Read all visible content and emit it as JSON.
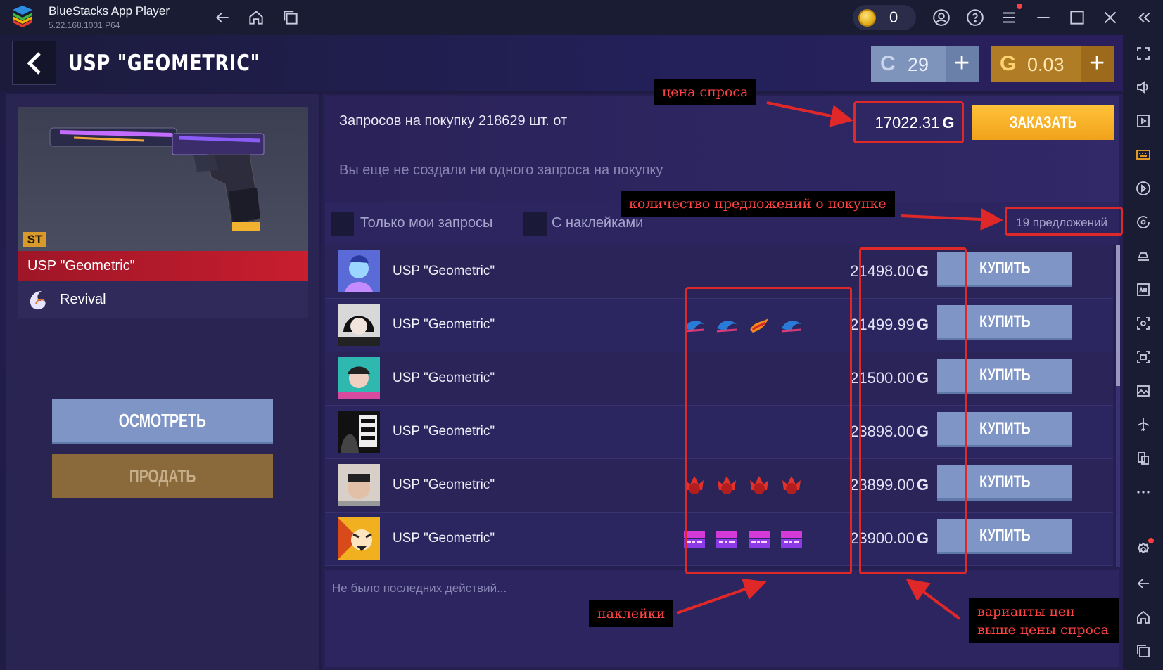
{
  "titlebar": {
    "app_name": "BlueStacks App Player",
    "version": "5.22.168.1001  P64",
    "coins": "0"
  },
  "sidebar_icons": [
    "fullscreen-icon",
    "volume-icon",
    "video-icon",
    "keyboard-icon",
    "play-icon",
    "rotate-icon",
    "shake-icon",
    "apk-icon",
    "screenshot-icon",
    "screen-record-icon",
    "media-icon",
    "airplane-icon",
    "multi-instance-icon",
    "more-icon",
    "settings-icon",
    "back-icon",
    "home-icon",
    "recent-apps-icon"
  ],
  "header": {
    "title": "USP \"GEOMETRIC\"",
    "silver_currency": "29",
    "gold_currency": "0.03"
  },
  "item": {
    "badge": "ST",
    "name": "USP \"Geometric\"",
    "collection": "Revival",
    "inspect_label": "ОСМОТРЕТЬ",
    "sell_label": "ПРОДАТЬ"
  },
  "request": {
    "text": "Запросов на покупку 218629 шт. от",
    "price": "17022.31",
    "order_label": "ЗАКАЗАТЬ",
    "none_text": "Вы еще не создали ни одного запроса на покупку"
  },
  "filters": {
    "only_mine": "Только мои запросы",
    "with_stickers": "С наклейками",
    "offers_count": "19 предложений"
  },
  "listings": [
    {
      "name": "USP \"Geometric\"",
      "price": "21498.00",
      "buy": "КУПИТЬ",
      "stickers": []
    },
    {
      "name": "USP \"Geometric\"",
      "price": "21499.99",
      "buy": "КУПИТЬ",
      "stickers": [
        "blue-shark-sticker",
        "blue-shark-sticker",
        "flame-sticker",
        "blue-shark-sticker"
      ]
    },
    {
      "name": "USP \"Geometric\"",
      "price": "21500.00",
      "buy": "КУПИТЬ",
      "stickers": []
    },
    {
      "name": "USP \"Geometric\"",
      "price": "23898.00",
      "buy": "КУПИТЬ",
      "stickers": []
    },
    {
      "name": "USP \"Geometric\"",
      "price": "23899.00",
      "buy": "КУПИТЬ",
      "stickers": [
        "red-skull-sticker",
        "red-skull-sticker",
        "red-skull-sticker",
        "red-skull-sticker"
      ]
    },
    {
      "name": "USP \"Geometric\"",
      "price": "23900.00",
      "buy": "КУПИТЬ",
      "stickers": [
        "kill-sticker",
        "kill-sticker",
        "kill-sticker",
        "kill-sticker"
      ]
    }
  ],
  "recent": "Не было последних действий...",
  "annotations": {
    "demand_price": "цена спроса",
    "offers_quantity": "количество предложений о покупке",
    "stickers": "наклейки",
    "price_variants_1": "варианты цен",
    "price_variants_2": "выше цены спроса"
  },
  "colors": {
    "accent_red": "#e12828",
    "buy_button": "#7e95c6",
    "order_button": "#f5a623"
  }
}
